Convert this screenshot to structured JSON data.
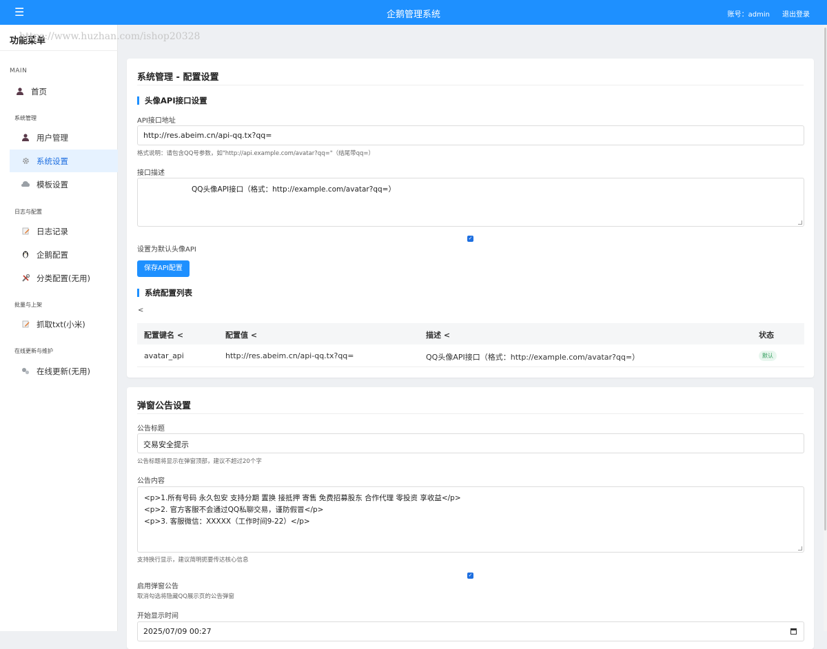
{
  "header": {
    "menu_icon": "☰",
    "app_title": "企鹅管理系统",
    "account": "账号：admin",
    "logout": "退出登录"
  },
  "watermark": "https://www.huzhan.com/ishop20328",
  "sidebar": {
    "title": "功能菜单",
    "main_label": "MAIN",
    "home": {
      "label": "首页",
      "icon": "user-icon"
    },
    "sections": [
      {
        "title": "系统管理"
      },
      {
        "title": "日志与配置"
      },
      {
        "title": "批量与上架"
      },
      {
        "title": "在线更新与维护"
      }
    ],
    "items": [
      {
        "label": "用户管理",
        "icon": "user-icon"
      },
      {
        "label": "系统设置",
        "icon": "gear-icon",
        "active": true
      },
      {
        "label": "模板设置",
        "icon": "cloud-icon"
      },
      {
        "label": "日志记录",
        "icon": "edit-icon"
      },
      {
        "label": "企鹅配置",
        "icon": "penguin-icon"
      },
      {
        "label": "分类配置(无用)",
        "icon": "tools-icon"
      },
      {
        "label": "抓取txt(小米)",
        "icon": "edit-icon"
      },
      {
        "label": "在线更新(无用)",
        "icon": "wrench-icon"
      }
    ]
  },
  "api_card": {
    "title": "系统管理 - 配置设置",
    "section_title": "头像API接口设置",
    "url_label": "API接口地址",
    "url_value": "http://res.abeim.cn/api-qq.tx?qq=",
    "url_hint": "格式说明：请包含QQ号参数，如\"http://api.example.com/avatar?qq=\"（结尾带qq=）",
    "desc_label": "接口描述",
    "desc_value": "QQ头像API接口（格式：http://example.com/avatar?qq=）",
    "default_checked": true,
    "default_label": "设置为默认头像API",
    "save_button": "保存API配置",
    "list_title": "系统配置列表",
    "list_back": "<",
    "table": {
      "headers": [
        "配置键名 <",
        "配置值 <",
        "描述 <",
        "状态"
      ],
      "rows": [
        {
          "key": "avatar_api",
          "value": "http://res.abeim.cn/api-qq.tx?qq=",
          "desc": "QQ头像API接口（格式：http://example.com/avatar?qq=）",
          "status": "默认"
        }
      ]
    }
  },
  "popup_card": {
    "title": "弹窗公告设置",
    "title_label": "公告标题",
    "title_value": "交易安全提示",
    "title_hint": "公告标题将显示在弹窗顶部，建议不超过20个字",
    "content_label": "公告内容",
    "content_lines": [
      "<p>1.所有号码  永久包安   支持分期  置换  接抵押  寄售   免费招募股东  合作代理  零投资  享收益</p>",
      "<p>2. 官方客服不会通过QQ私聊交易，谨防假冒</p>",
      "<p>3. 客服微信：XXXXX（工作时间9-22）</p>"
    ],
    "content_hint": "支持换行显示，建议简明扼要传达核心信息",
    "enable_checked": true,
    "enable_label": "启用弹窗公告",
    "enable_hint": "取消勾选将隐藏QQ展示页的公告弹窗",
    "start_label": "开始显示时间",
    "start_value": "2025/07/09 00:27"
  },
  "colors": {
    "primary": "#1e90ff",
    "active_bg": "#e6f2ff",
    "badge_bg": "#e8f6ee",
    "badge_text": "#2e9c5a"
  }
}
